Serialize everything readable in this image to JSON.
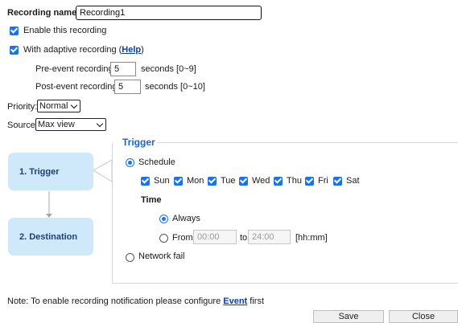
{
  "recording_name": {
    "label": "Recording name:",
    "value": "Recording1"
  },
  "enable": {
    "label": "Enable this recording"
  },
  "adaptive": {
    "label": "With adaptive recording (",
    "link": "Help",
    "close": ")"
  },
  "pre_event": {
    "label": "Pre-event recording:",
    "value": "5",
    "unit": "seconds [0~9]"
  },
  "post_event": {
    "label": "Post-event recording:",
    "value": "5",
    "unit": "seconds [0~10]"
  },
  "priority": {
    "label": "Priority:",
    "value": "Normal"
  },
  "source": {
    "label": "Source:",
    "value": "Max view"
  },
  "steps": [
    {
      "label": "1.  Trigger"
    },
    {
      "label": "2.  Destination"
    }
  ],
  "trigger": {
    "title": "Trigger",
    "schedule_label": "Schedule",
    "days": [
      "Sun",
      "Mon",
      "Tue",
      "Wed",
      "Thu",
      "Fri",
      "Sat"
    ],
    "time_label": "Time",
    "always_label": "Always",
    "from_label": "From",
    "from_value": "00:00",
    "to_label": "to",
    "to_value": "24:00",
    "format_hint": "[hh:mm]",
    "network_fail_label": "Network fail"
  },
  "note": {
    "text": "Note: To enable recording notification please configure ",
    "link": "Event",
    "suffix": " first"
  },
  "buttons": {
    "save": "Save",
    "close": "Close"
  },
  "colors": {
    "accent": "#1a73e8",
    "step_bg": "#cfe9fb",
    "section_title": "#1a67c8"
  }
}
